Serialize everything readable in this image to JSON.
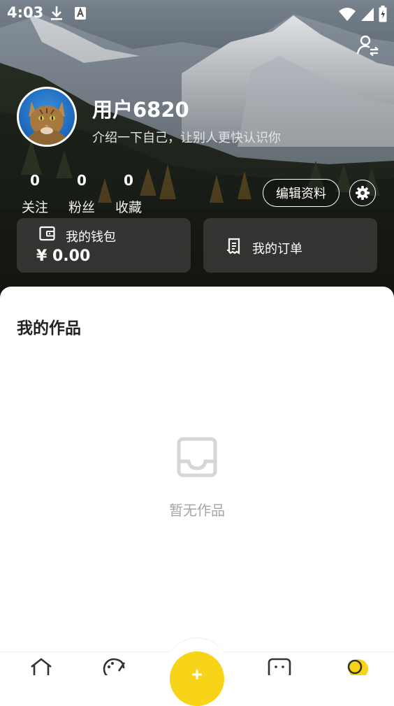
{
  "status_bar": {
    "time": "4:03"
  },
  "profile": {
    "username": "用户6820",
    "bio": "介绍一下自己，让别人更快认识你"
  },
  "stats": [
    {
      "value": "0",
      "label": "关注"
    },
    {
      "value": "0",
      "label": "粉丝"
    },
    {
      "value": "0",
      "label": "收藏"
    }
  ],
  "actions": {
    "edit_profile": "编辑资料"
  },
  "wallet": {
    "label": "我的钱包",
    "amount": "¥ 0.00"
  },
  "orders": {
    "label": "我的订单"
  },
  "works": {
    "title": "我的作品",
    "empty_text": "暂无作品"
  },
  "colors": {
    "accent": "#f7d417",
    "empty_gray": "#a6a6a6"
  },
  "icons": [
    "download-icon",
    "notification-a-icon",
    "wifi-icon",
    "signal-icon",
    "battery-icon",
    "switch-account-icon",
    "settings-icon",
    "wallet-icon",
    "order-icon",
    "inbox-empty-icon",
    "home-icon",
    "palette-icon",
    "add-icon",
    "message-icon",
    "profile-icon"
  ]
}
